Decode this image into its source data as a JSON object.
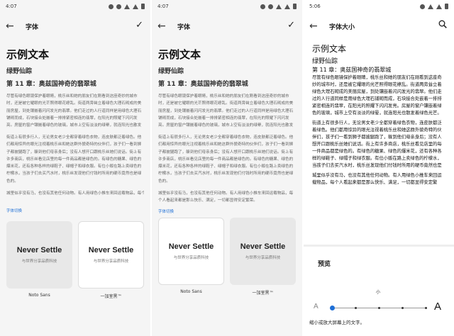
{
  "colors": {
    "accent": "#1e6fd6"
  },
  "panels": [
    {
      "time": "4:07",
      "title": "字体",
      "action_icon": "check-icon",
      "h1": "示例文本",
      "h2": "绿野仙踪",
      "h3": "第 11 章：奥兹国神奇的翡翠城",
      "para1": "尽管有绿色眼镜保护着眼睛，桃乐丝和她的朋友们在刚看到这座奇妙的城市时，还是被它耀眼的光芒照得眼花缭乱。街道两旁耸立着绿色大理石砌成的美丽房屋，到处镶嵌着闪闪发光的翡翠。他们走过的人行道同样是用绿色大理石铺砌而成，石块接合处嵌着一排排紧密相连的翡翠，在阳光的照耀下闪闪发亮。房屋的窗户镶嵌着绿色的玻璃，城市上空有淡淡的绿晕，就连阳光也散发着绿色光芒。",
      "para2": "街道上有很多行人，无论男女老少全都穿着绿色衣物，连皮肤都泛着绿色。他们都用惊异的眼光注视着桃乐丝和她这群外貌奇特的伙伴们，孩子们一看到狮子都披腿跑了，躲到他们母亲身后；没有人想开口跟桃乐丝她们说话。街上有许多商店，桃乐丝看见店里的每一件商品都是绿色的。有绿色的糖果、绿色的爆米花，还有各种各样的绿鞋子、绿帽子和绿衣服。有位小贩在路上卖绿色的柠檬水，当孩子们去买汽水时，桃乐丝发现他们付钱时所用的硬币竟然也是绿色的。",
      "para3": "城里似乎没有马，也没有其他任何动物。有人用绿色小推车来回运载物品，每个人看起来都是那么快乐、满足，一切都显得安定繁荣。",
      "section_label": "字体切换",
      "cards": [
        {
          "title": "Never Settle",
          "subtitle": "与世界分享品质科技",
          "name": "Noto Sans"
        },
        {
          "title": "Never Settle",
          "subtitle": "与世界分享品质科技",
          "name": "一加室黑™"
        }
      ]
    },
    {
      "time": "4:07",
      "title": "字体",
      "action_icon": "check-icon",
      "h1": "示例文本",
      "h2": "绿野仙踪",
      "h3": "第 11 章：奥兹国神奇的翡翠城",
      "para1": "尽管有绿色眼镜保护着眼睛，桃乐丝和她的朋友们在刚看到这座奇妙的城市时，还是被它耀眼的光芒照得眼花缭乱。街道两旁耸立着绿色大理石砌成的美丽房屋，到处镶嵌着闪闪发光的翡翠。他们走过的人行道同样是用绿色大理石铺砌而成，石块接合处嵌着一排排紧密相连的翡翠，在阳光的照耀下闪闪发亮。房屋的窗户镶嵌着绿色的玻璃，城市上空有淡淡的绿晕，就连阳光也散发着绿色光芒。",
      "para2": "街道上有很多行人，无论男女老少全都穿着绿色衣物，连皮肤都泛着绿色。他们都用惊异的眼光注视着桃乐丝和她这群外貌奇特的伙伴们，孩子们一看到狮子都披腿跑了，躲到他们母亲身后；没有人想开口跟桃乐丝她们说话。街上有许多商店，桃乐丝看见店里的每一件商品都是绿色的。有绿色的糖果、绿色的爆米花，还有各种各样的绿鞋子、绿帽子和绿衣服。有位小贩在路上卖绿色的柠檬水，当孩子们去买汽水时，桃乐丝发现他们付钱时所用的硬币竟然也是绿色的。",
      "para3": "城里似乎没有马，也没有其他任何动物。有人用绿色小推车来回运载物品，每个人看起来都是那么快乐、满足，一切都显得安定繁荣。",
      "section_label": "字体切换",
      "cards": [
        {
          "title": "Never Settle",
          "subtitle": "与世界分享品质科技",
          "name": "Noto Sans"
        },
        {
          "title": "Never Settle",
          "subtitle": "与世界分享品质科技",
          "name": "一加室黑™"
        }
      ]
    },
    {
      "time": "5:06",
      "title": "字体大小",
      "action_icon": "search-icon",
      "h1": "示例文本",
      "h2": "绿野仙踪",
      "h3": "第 11 章：奥兹国神奇的翡翠城",
      "para1": "尽管有绿色眼镜保护着眼睛，桃乐丝和她的朋友们在刚看到这座奇妙的城市时，还是被它耀眼的光芒照得眼花缭乱。街道两旁耸立着绿色大理石砌成的美丽房屋，到处镶嵌着闪闪发光的翡翠。他们走过的人行道同样是用绿色大理石铺砌而成，石块接合处嵌着一排排紧密相连的翡翠，在阳光的照耀下闪闪发亮。房屋的窗户镶嵌着绿色的玻璃，城市上空有淡淡的绿晕，就连阳光也散发着绿色光芒。",
      "para2": "街道上有很多行人，无论男女老少全都穿着绿色衣物，连皮肤都泛着绿色。他们都用惊异的眼光注视着桃乐丝和她这群外貌奇特的伙伴们，孩子们一看到狮子都披腿跑了，躲到他们母亲身后；没有人想开口跟桃乐丝她们说话。街上有许多商店，桃乐丝看见店里的每一件商品都是绿色的。有绿色的糖果、绿色的爆米花，还有各种各样的绿鞋子、绿帽子和绿衣服。有位小贩在路上卖绿色的柠檬水，当孩子们去买汽水时，桃乐丝发现他们付钱时所用的硬币竟然也是绿色的。",
      "para3": "城里似乎没有马，也没有其他任何动物。有人用绿色小推车来回运载物品，每个人看起来都是那么快乐、满足，一切都显得安定繁荣。",
      "preview_title": "预览",
      "slider": {
        "current_label": "小",
        "min_label": "A",
        "max_label": "A",
        "steps": 5,
        "selected_index": 0,
        "caption": "缩小或放大屏幕上的文字。"
      }
    }
  ]
}
